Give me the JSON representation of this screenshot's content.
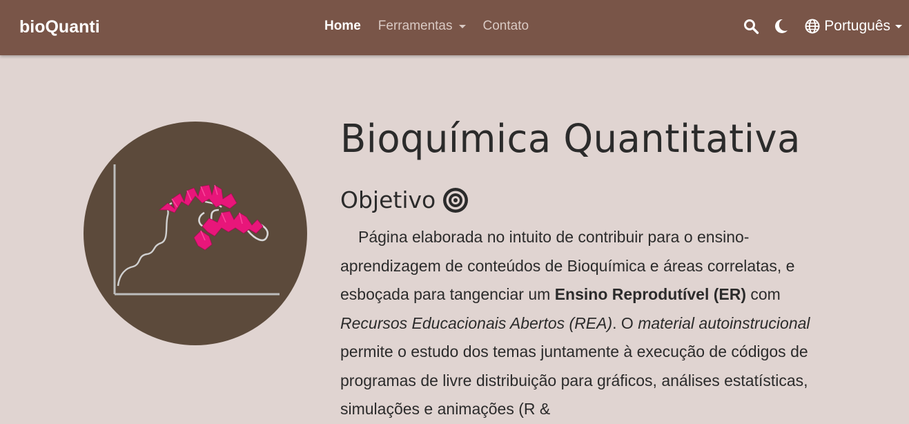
{
  "navbar": {
    "brand": "bioQuanti",
    "links": [
      {
        "label": "Home"
      },
      {
        "label": "Ferramentas"
      },
      {
        "label": "Contato"
      }
    ],
    "language": "Português"
  },
  "hero": {
    "title": "Bioquímica Quantitativa",
    "subtitle": "Objetivo",
    "paragraph": {
      "part1": "Página elaborada no intuito de contribuir para o ensino-aprendizagem de conteúdos de Bioquímica e áreas correlatas, e esboçada para tangenciar um ",
      "bold1": "Ensino Reprodutível (ER)",
      "part2": " com ",
      "italic1": "Recursos Educacionais Abertos (REA)",
      "part3": ". O ",
      "italic2": "material autoinstrucional",
      "part4": " permite o estudo dos temas juntamente à execução de códigos de programas de livre distribuição para gráficos, análises estatísticas, simulações e animações (R &"
    }
  },
  "colors": {
    "navbar": "#795548",
    "background": "#e0d4d1",
    "image_circle": "#5c4a3b",
    "protein": "#e8167a"
  },
  "icons": [
    "search-icon",
    "moon-icon",
    "globe-icon",
    "target-icon"
  ]
}
